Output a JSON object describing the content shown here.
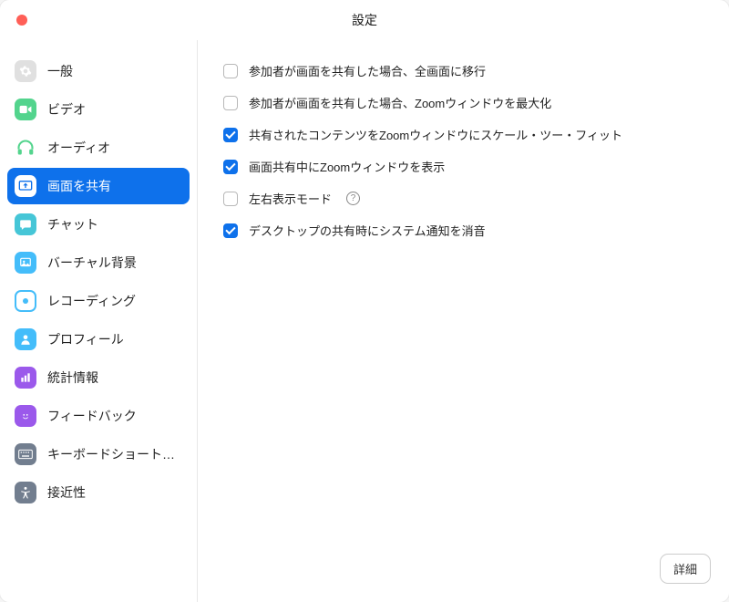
{
  "window": {
    "title": "設定"
  },
  "sidebar": {
    "items": [
      {
        "label": "一般"
      },
      {
        "label": "ビデオ"
      },
      {
        "label": "オーディオ"
      },
      {
        "label": "画面を共有"
      },
      {
        "label": "チャット"
      },
      {
        "label": "バーチャル背景"
      },
      {
        "label": "レコーディング"
      },
      {
        "label": "プロフィール"
      },
      {
        "label": "統計情報"
      },
      {
        "label": "フィードバック"
      },
      {
        "label": "キーボードショートカ…"
      },
      {
        "label": "接近性"
      }
    ]
  },
  "options": [
    {
      "label": "参加者が画面を共有した場合、全画面に移行",
      "checked": false
    },
    {
      "label": "参加者が画面を共有した場合、Zoomウィンドウを最大化",
      "checked": false
    },
    {
      "label": "共有されたコンテンツをZoomウィンドウにスケール・ツー・フィット",
      "checked": true
    },
    {
      "label": "画面共有中にZoomウィンドウを表示",
      "checked": true
    },
    {
      "label": "左右表示モード",
      "checked": false,
      "help": true
    },
    {
      "label": "デスクトップの共有時にシステム通知を消音",
      "checked": true
    }
  ],
  "buttons": {
    "advanced": "詳細"
  },
  "colors": {
    "accent": "#0e71eb",
    "iconGray": "#e0e0e0",
    "iconBlue": "#44bdfa",
    "iconGreen": "#53d48d",
    "iconCyan": "#46c6d7",
    "iconPurple": "#9b59eb",
    "iconSlate": "#727e8f"
  }
}
